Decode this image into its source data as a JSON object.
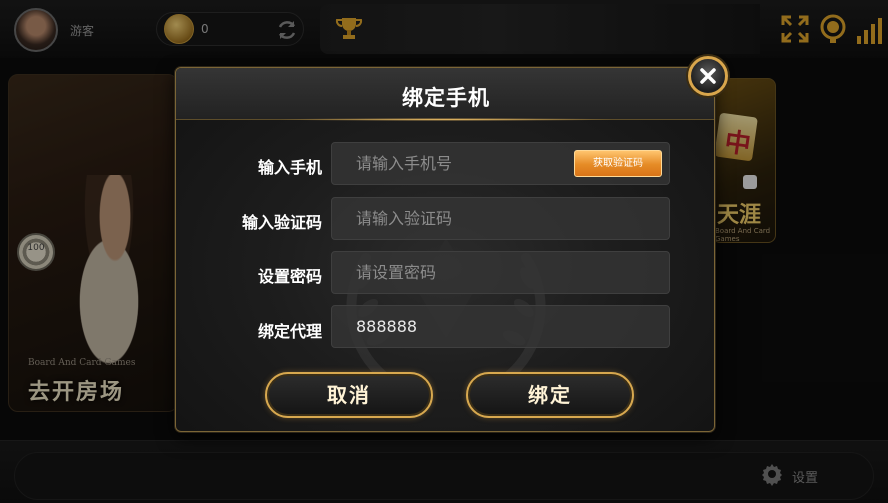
{
  "header": {
    "username": "游客",
    "coin_value": "0"
  },
  "lobby": {
    "room_card_subtitle": "Board And Card Games",
    "room_card_title": "去开房场",
    "chip_value": "100",
    "right_card_char": "中",
    "right_card_title": "天涯",
    "right_card_subtitle": "Board And Card Games"
  },
  "footer": {
    "settings_label": "设置"
  },
  "dialog": {
    "title": "绑定手机",
    "fields": [
      {
        "label": "输入手机",
        "placeholder": "请输入手机号",
        "value": ""
      },
      {
        "label": "输入验证码",
        "placeholder": "请输入验证码",
        "value": ""
      },
      {
        "label": "设置密码",
        "placeholder": "请设置密码",
        "value": ""
      },
      {
        "label": "绑定代理",
        "placeholder": "",
        "value": "888888"
      }
    ],
    "get_code_label": "获取验证码",
    "cancel_label": "取消",
    "bind_label": "绑定"
  },
  "colors": {
    "accent_gold": "#d7a84f",
    "code_button_orange": "#e58b26",
    "dialog_background": "#1d1d1d"
  },
  "icons": [
    "refresh-icon",
    "trophy-icon",
    "fullscreen-icon",
    "customer-service-icon",
    "signal-icon",
    "settings-icon",
    "close-icon"
  ]
}
